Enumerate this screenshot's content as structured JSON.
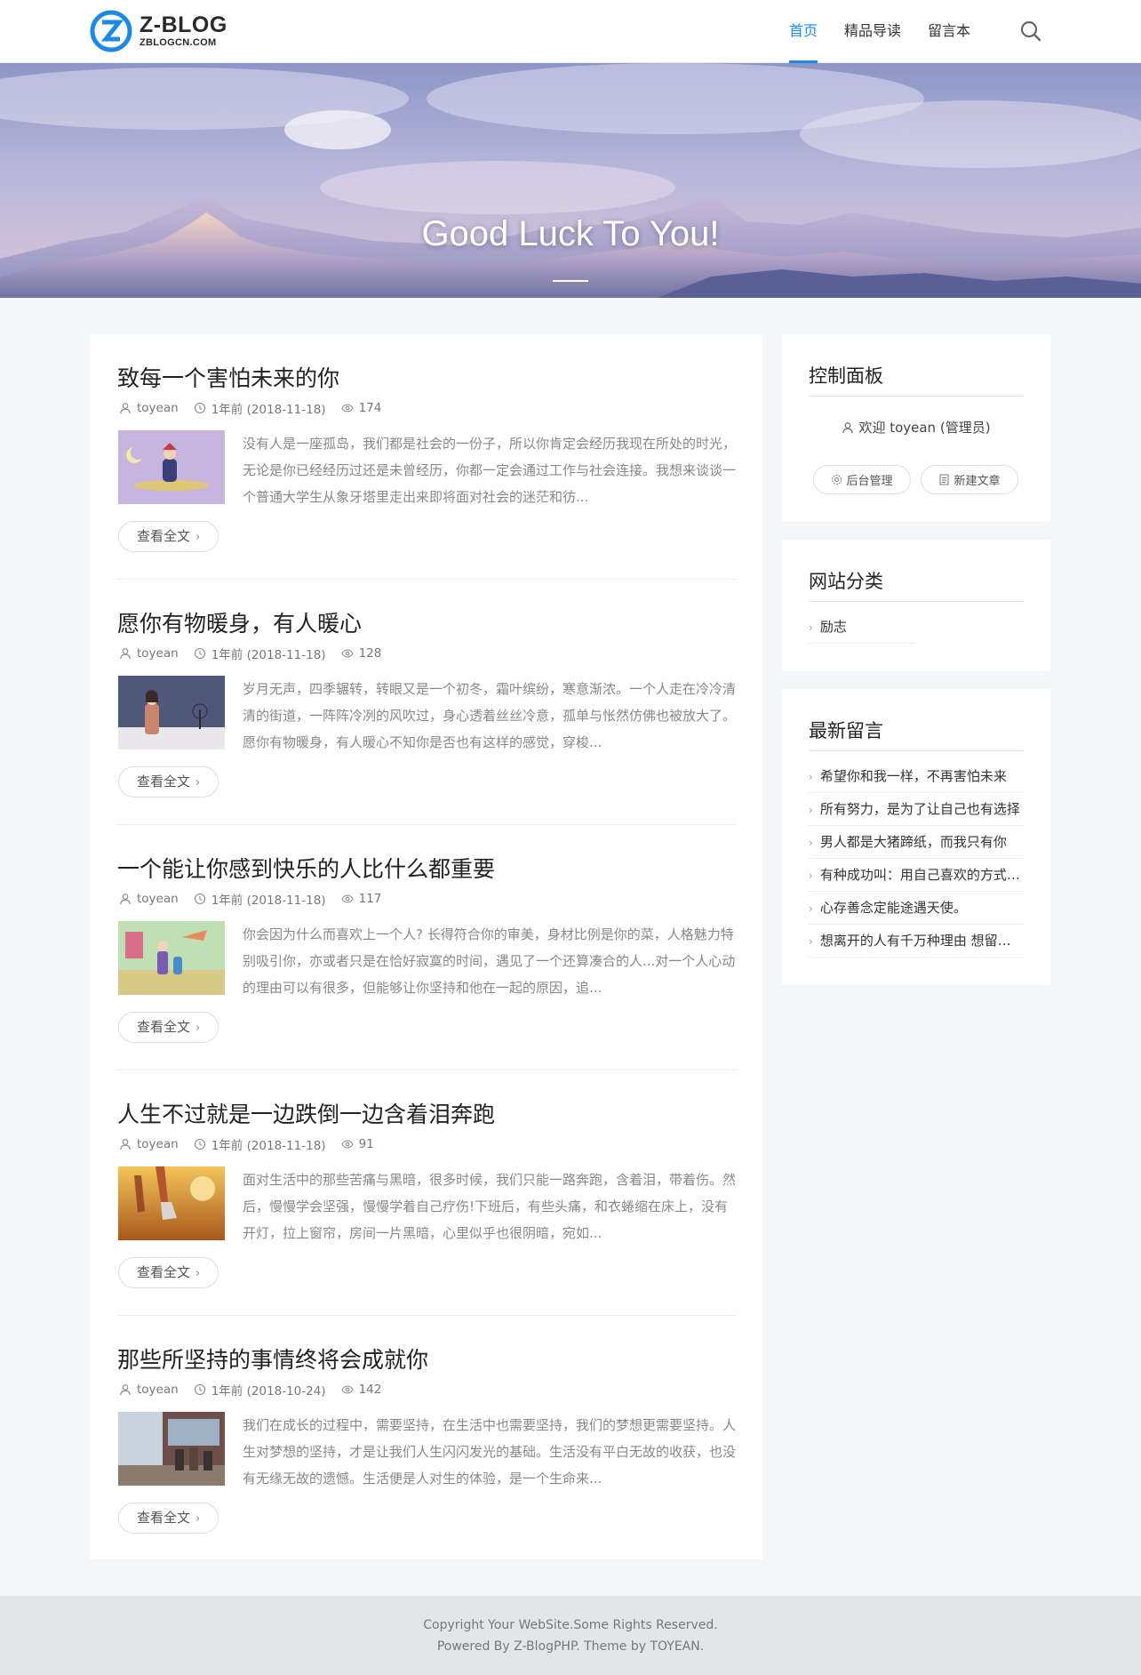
{
  "header": {
    "logo_name": "Z-BLOG",
    "logo_sub": "ZBLOGCN.COM",
    "nav": [
      {
        "label": "首页",
        "active": true
      },
      {
        "label": "精品导读",
        "active": false
      },
      {
        "label": "留言本",
        "active": false
      }
    ],
    "search_icon": "search-icon"
  },
  "banner": {
    "title": "Good Luck To You!"
  },
  "posts": [
    {
      "title": "致每一个害怕未来的你",
      "author": "toyean",
      "date": "1年前 (2018-11-18)",
      "views": "174",
      "excerpt": "没有人是一座孤岛，我们都是社会的一份子，所以你肯定会经历我现在所处的时光，无论是你已经经历过还是未曾经历，你都一定会通过工作与社会连接。我想来谈谈一个普通大学生从象牙塔里走出来即将面对社会的迷茫和彷...",
      "read_more": "查看全文"
    },
    {
      "title": "愿你有物暖身，有人暖心",
      "author": "toyean",
      "date": "1年前 (2018-11-18)",
      "views": "128",
      "excerpt": "岁月无声，四季辗转，转眼又是一个初冬，霜叶缤纷，寒意渐浓。一个人走在冷冷清清的街道，一阵阵冷冽的风吹过，身心透着丝丝冷意，孤单与怅然仿佛也被放大了。愿你有物暖身，有人暖心不知你是否也有这样的感觉，穿梭...",
      "read_more": "查看全文"
    },
    {
      "title": "一个能让你感到快乐的人比什么都重要",
      "author": "toyean",
      "date": "1年前 (2018-11-18)",
      "views": "117",
      "excerpt": "你会因为什么而喜欢上一个人? 长得符合你的审美，身材比例是你的菜，人格魅力特别吸引你，亦或者只是在恰好寂寞的时间，遇见了一个还算凑合的人...对一个人心动的理由可以有很多，但能够让你坚持和他在一起的原因，追...",
      "read_more": "查看全文"
    },
    {
      "title": "人生不过就是一边跌倒一边含着泪奔跑",
      "author": "toyean",
      "date": "1年前 (2018-11-18)",
      "views": "91",
      "excerpt": "面对生活中的那些苦痛与黑暗，很多时候，我们只能一路奔跑，含着泪，带着伤。然后，慢慢学会坚强，慢慢学着自己疗伤!下班后，有些头痛，和衣蜷缩在床上，没有开灯，拉上窗帘，房间一片黑暗，心里似乎也很阴暗，宛如...",
      "read_more": "查看全文"
    },
    {
      "title": "那些所坚持的事情终将会成就你",
      "author": "toyean",
      "date": "1年前 (2018-10-24)",
      "views": "142",
      "excerpt": "我们在成长的过程中，需要坚持，在生活中也需要坚持，我们的梦想更需要坚持。人生对梦想的坚持，才是让我们人生闪闪发光的基础。生活没有平白无故的收获，也没有无缘无故的遗憾。生活便是人对生的体验，是一个生命来...",
      "read_more": "查看全文"
    }
  ],
  "sidebar": {
    "control": {
      "title": "控制面板",
      "welcome": "欢迎 toyean (管理员)",
      "admin_label": "后台管理",
      "new_post_label": "新建文章"
    },
    "categories": {
      "title": "网站分类",
      "items": [
        "励志"
      ]
    },
    "comments": {
      "title": "最新留言",
      "items": [
        "希望你和我一样，不再害怕未来",
        "所有努力，是为了让自己也有选择",
        "男人都是大猪蹄纸，而我只有你",
        "有种成功叫：用自己喜欢的方式过一生",
        "心存善念定能途遇天使。",
        "想离开的人有千万种理由 想留下的人"
      ]
    }
  },
  "footer": {
    "line1": "Copyright Your WebSite.Some Rights Reserved.",
    "powered_prefix": "Powered By ",
    "powered_link": "Z-BlogPHP",
    "theme_text": ". Theme by ",
    "theme_link": "TOYEAN",
    "end": "."
  },
  "colors": {
    "accent": "#1e88e5",
    "background": "#f5f6f8",
    "footer_bg": "#e3e5e8"
  }
}
